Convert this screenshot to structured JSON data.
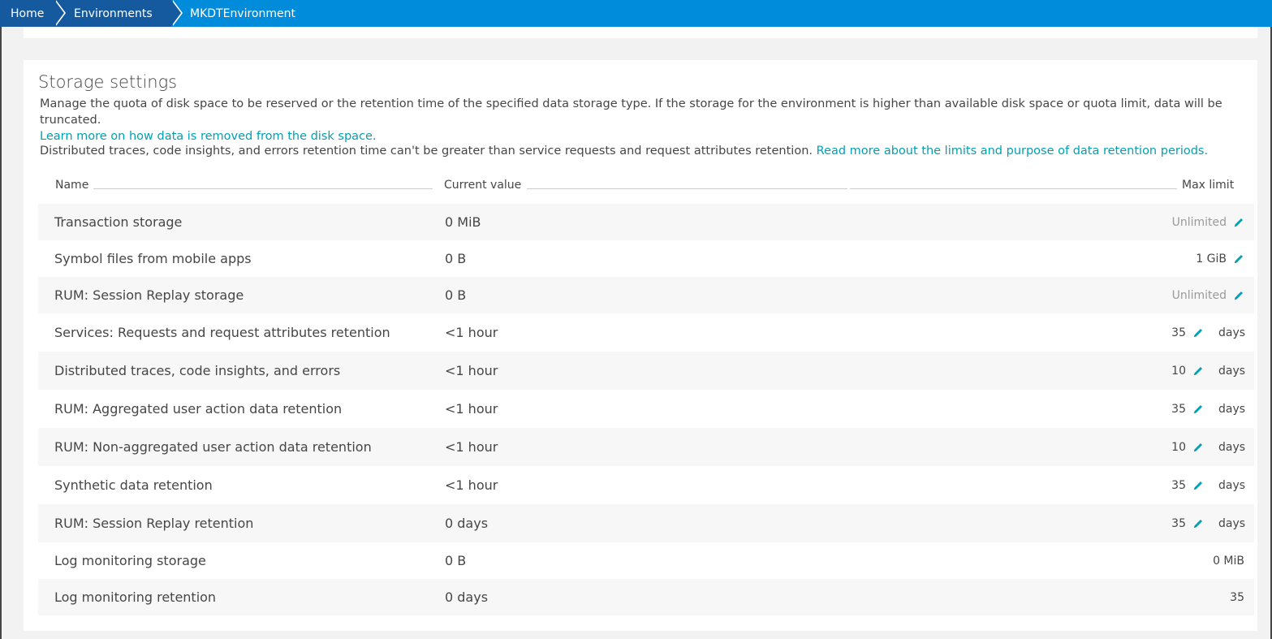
{
  "breadcrumb": {
    "home": "Home",
    "environments": "Environments",
    "current": "MKDTEnvironment"
  },
  "storage": {
    "title": "Storage settings",
    "description": "Manage the quota of disk space to be reserved or the retention time of the specified data storage type. If the storage for the environment is higher than available disk space or quota limit, data will be truncated.",
    "learn_more_link": "Learn more on how data is removed from the disk space.",
    "retention_note": "Distributed traces, code insights, and errors retention time can't be greater than service requests and request attributes retention.",
    "read_more_link": "Read more about the limits and purpose of data retention periods.",
    "columns": {
      "name": "Name",
      "current": "Current value",
      "max": "Max limit"
    },
    "rows": [
      {
        "name": "Transaction storage",
        "current": "0 MiB",
        "max": "Unlimited",
        "unit": ""
      },
      {
        "name": "Symbol files from mobile apps",
        "current": "0 B",
        "max": "1 GiB",
        "unit": ""
      },
      {
        "name": "RUM: Session Replay storage",
        "current": "0 B",
        "max": "Unlimited",
        "unit": ""
      },
      {
        "name": "Services: Requests and request attributes retention",
        "current": "<1 hour",
        "max": "35",
        "unit": "days"
      },
      {
        "name": "Distributed traces, code insights, and errors",
        "current": "<1 hour",
        "max": "10",
        "unit": "days"
      },
      {
        "name": "RUM: Aggregated user action data retention",
        "current": "<1 hour",
        "max": "35",
        "unit": "days"
      },
      {
        "name": "RUM: Non-aggregated user action data retention",
        "current": "<1 hour",
        "max": "10",
        "unit": "days"
      },
      {
        "name": "Synthetic data retention",
        "current": "<1 hour",
        "max": "35",
        "unit": "days"
      },
      {
        "name": "RUM: Session Replay retention",
        "current": "0 days",
        "max": "35",
        "unit": "days"
      },
      {
        "name": "Log monitoring storage",
        "current": "0 B",
        "max": "0 MiB",
        "unit": ""
      },
      {
        "name": "Log monitoring retention",
        "current": "0 days",
        "max": "35",
        "unit": ""
      }
    ]
  },
  "colors": {
    "accent": "#00a1b2",
    "header": "#008cdb",
    "crumb_dark": "#155a9e"
  }
}
